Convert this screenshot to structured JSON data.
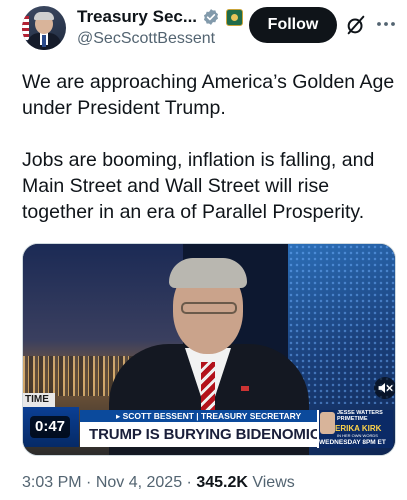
{
  "header": {
    "display_name": "Treasury Sec...",
    "handle": "@SecScottBessent",
    "follow_label": "Follow"
  },
  "tweet": {
    "paragraphs": [
      "We are approaching America’s Golden Age under President Trump.",
      "Jobs are booming, inflation is falling, and Main Street and Wall Street will rise together in an era of Parallel Prosperity."
    ]
  },
  "video": {
    "duration": "0:47",
    "chyron_corner": "TIME",
    "lower_third_name": "▸ SCOTT BESSENT | TREASURY SECRETARY",
    "lower_third_headline": "TRUMP IS BURYING BIDENOMICS",
    "promo_show": "JESSE WATTERS PRIMETIME",
    "promo_guest": "ERIKA KIRK",
    "promo_sub": "IN HER OWN WORDS",
    "promo_time": "WEDNESDAY 8PM ET"
  },
  "meta": {
    "time": "3:03 PM",
    "separator": " · ",
    "date": "Nov 4, 2025",
    "views_count": "345.2K",
    "views_label": " Views"
  },
  "colors": {
    "accent": "#1d9bf0",
    "text": "#0f1419",
    "muted": "#536471",
    "follow_bg": "#0f1419"
  },
  "icons": {
    "verified": "verified-badge-icon",
    "affiliate": "treasury-seal-icon",
    "grok": "grok-icon",
    "more": "more-dots-icon",
    "mute": "volume-muted-icon"
  }
}
